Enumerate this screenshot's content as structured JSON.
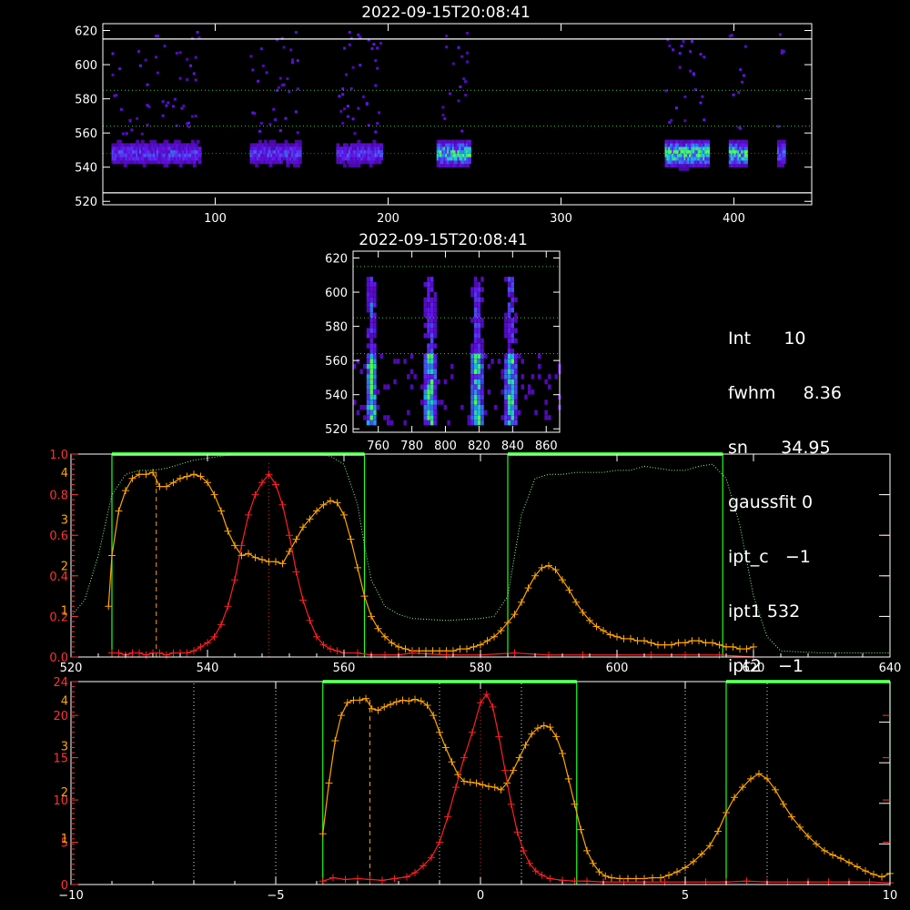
{
  "top_panel": {
    "title": "2022-09-15T20:08:41",
    "x_ticks": [
      "100",
      "200",
      "300",
      "400"
    ],
    "x_tick_values": [
      100,
      200,
      300,
      400
    ],
    "xlim": [
      35,
      445
    ],
    "y_ticks": [
      "520",
      "540",
      "560",
      "580",
      "600",
      "620"
    ],
    "y_tick_values": [
      520,
      540,
      560,
      580,
      600,
      620
    ],
    "ylim": [
      518,
      624
    ],
    "white_lines": [
      525,
      615
    ],
    "green_dotted_lines": [
      564,
      585,
      615
    ],
    "red_dotted_line": 548,
    "blobs": [
      {
        "x0": 40,
        "x1": 90,
        "intensity": 0.45
      },
      {
        "x0": 120,
        "x1": 148,
        "intensity": 0.45
      },
      {
        "x0": 170,
        "x1": 195,
        "intensity": 0.45
      },
      {
        "x0": 228,
        "x1": 246,
        "intensity": 0.9
      },
      {
        "x0": 360,
        "x1": 384,
        "intensity": 1.0
      },
      {
        "x0": 397,
        "x1": 406,
        "intensity": 0.9
      },
      {
        "x0": 425,
        "x1": 428,
        "intensity": 0.6
      }
    ]
  },
  "mid_panel": {
    "title": "2022-09-15T20:08:41",
    "x_ticks": [
      "760",
      "780",
      "800",
      "820",
      "840",
      "860"
    ],
    "x_tick_values": [
      760,
      780,
      800,
      820,
      840,
      860
    ],
    "xlim": [
      745,
      868
    ],
    "y_ticks": [
      "520",
      "540",
      "560",
      "580",
      "600",
      "620"
    ],
    "y_tick_values": [
      520,
      540,
      560,
      580,
      600,
      620
    ],
    "ylim": [
      518,
      624
    ],
    "stripes": [
      755,
      790,
      818,
      838
    ],
    "green_dotted_lines": [
      564,
      585,
      615
    ]
  },
  "info_text": [
    {
      "label": "Int",
      "value": "10",
      "line": "Int      10"
    },
    {
      "label": "fwhm",
      "value": "8.36",
      "line": "fwhm     8.36"
    },
    {
      "label": "sn",
      "value": "34.95",
      "line": "sn      34.95"
    },
    {
      "label": "gaussfit",
      "value": "0",
      "line": "gaussfit 0"
    },
    {
      "label": "ipt_c",
      "value": "−1",
      "line": "ipt_c   −1"
    },
    {
      "label": "ipt1",
      "value": "532",
      "line": "ipt1 532"
    },
    {
      "label": "ipt2",
      "value": "−1",
      "line": "ipt2   −1"
    }
  ],
  "chart_data": [
    {
      "type": "line",
      "x_ticks": [
        "520",
        "540",
        "560",
        "580",
        "600",
        "620",
        "640"
      ],
      "x_tick_values": [
        520,
        540,
        560,
        580,
        600,
        620,
        640
      ],
      "xlim": [
        520,
        640
      ],
      "left_y_ticks": [
        "0.0",
        "0.2",
        "0.4",
        "0.6",
        "0.8",
        "1.0"
      ],
      "left_y_tick_values": [
        0,
        0.2,
        0.4,
        0.6,
        0.8,
        1.0
      ],
      "ylim": [
        0,
        1.0
      ],
      "overlay_y_ticks": [
        "1",
        "2",
        "3",
        "4"
      ],
      "overlay_y_tick_values": [
        0.23,
        0.45,
        0.68,
        0.91
      ],
      "filter_bands": [
        [
          526,
          563
        ],
        [
          584,
          615.5
        ]
      ],
      "vlines_dashed_orange": [
        532.5
      ],
      "vlines_dotted_red": [
        549
      ],
      "green_dotted": {
        "x": [
          520,
          522,
          524,
          526,
          528,
          530,
          532,
          534,
          536,
          538,
          540,
          542,
          544,
          546,
          548,
          550,
          552,
          554,
          556,
          558,
          560,
          562,
          563,
          564,
          566,
          568,
          570,
          575,
          580,
          582,
          584,
          586,
          588,
          590,
          592,
          594,
          596,
          598,
          600,
          602,
          604,
          606,
          608,
          610,
          612,
          614,
          616,
          618,
          620,
          622,
          624,
          630,
          640
        ],
        "y": [
          0.2,
          0.28,
          0.5,
          0.8,
          0.9,
          0.92,
          0.92,
          0.93,
          0.95,
          0.97,
          0.98,
          0.99,
          1.0,
          1.0,
          1.0,
          1.0,
          1.0,
          1.0,
          1.0,
          0.99,
          0.95,
          0.75,
          0.55,
          0.38,
          0.25,
          0.21,
          0.19,
          0.18,
          0.19,
          0.2,
          0.3,
          0.7,
          0.88,
          0.9,
          0.9,
          0.91,
          0.91,
          0.91,
          0.92,
          0.92,
          0.94,
          0.93,
          0.92,
          0.92,
          0.94,
          0.95,
          0.88,
          0.65,
          0.3,
          0.1,
          0.03,
          0.02,
          0.02
        ]
      },
      "series": [
        {
          "name": "",
          "color": "#ffa500",
          "x": [
            525.5,
            526,
            527,
            528,
            529,
            530,
            531,
            532,
            533,
            534,
            535,
            536,
            537,
            538,
            539,
            540,
            541,
            542,
            543,
            544,
            545,
            546,
            547,
            548,
            549,
            550,
            551,
            552,
            553,
            554,
            555,
            556,
            557,
            558,
            559,
            560,
            561,
            562,
            563,
            564,
            565,
            566,
            567,
            568,
            569,
            570,
            571,
            572,
            573,
            574,
            575,
            576,
            577,
            578,
            579,
            580,
            581,
            582,
            583,
            584,
            585,
            586,
            587,
            588,
            589,
            590,
            591,
            592,
            593,
            594,
            595,
            596,
            597,
            598,
            599,
            600,
            601,
            602,
            603,
            604,
            605,
            606,
            607,
            608,
            609,
            610,
            611,
            612,
            613,
            614,
            615,
            616,
            617,
            618,
            619,
            620
          ],
          "y": [
            0.25,
            0.5,
            0.72,
            0.82,
            0.88,
            0.9,
            0.9,
            0.91,
            0.84,
            0.84,
            0.86,
            0.88,
            0.89,
            0.9,
            0.89,
            0.86,
            0.8,
            0.72,
            0.62,
            0.55,
            0.5,
            0.51,
            0.49,
            0.48,
            0.47,
            0.47,
            0.46,
            0.52,
            0.58,
            0.64,
            0.68,
            0.72,
            0.75,
            0.77,
            0.76,
            0.7,
            0.58,
            0.44,
            0.3,
            0.2,
            0.14,
            0.1,
            0.07,
            0.05,
            0.04,
            0.03,
            0.03,
            0.03,
            0.03,
            0.03,
            0.03,
            0.03,
            0.04,
            0.04,
            0.05,
            0.06,
            0.08,
            0.1,
            0.13,
            0.17,
            0.21,
            0.27,
            0.34,
            0.4,
            0.44,
            0.45,
            0.43,
            0.38,
            0.33,
            0.27,
            0.22,
            0.18,
            0.15,
            0.13,
            0.11,
            0.1,
            0.09,
            0.09,
            0.08,
            0.08,
            0.07,
            0.06,
            0.06,
            0.06,
            0.07,
            0.07,
            0.08,
            0.08,
            0.07,
            0.07,
            0.06,
            0.05,
            0.05,
            0.04,
            0.04,
            0.05
          ]
        },
        {
          "name": "",
          "color": "#ff2020",
          "x": [
            526,
            527,
            528,
            529,
            530,
            531,
            532,
            533,
            534,
            535,
            536,
            537,
            538,
            539,
            540,
            541,
            542,
            543,
            544,
            545,
            546,
            547,
            548,
            549,
            550,
            551,
            552,
            553,
            554,
            555,
            556,
            557,
            558,
            559,
            560,
            562,
            564,
            566,
            568,
            570,
            575,
            580,
            585,
            590,
            595,
            600,
            605,
            610,
            615,
            620
          ],
          "y": [
            0.02,
            0.02,
            0.01,
            0.02,
            0.02,
            0.01,
            0.02,
            0.02,
            0.01,
            0.02,
            0.02,
            0.02,
            0.03,
            0.05,
            0.07,
            0.1,
            0.16,
            0.25,
            0.38,
            0.55,
            0.7,
            0.8,
            0.86,
            0.9,
            0.85,
            0.75,
            0.6,
            0.42,
            0.28,
            0.18,
            0.1,
            0.06,
            0.04,
            0.03,
            0.02,
            0.02,
            0.01,
            0.01,
            0.01,
            0.02,
            0.01,
            0.01,
            0.02,
            0.01,
            0.01,
            0.01,
            0.01,
            0.01,
            0.01,
            0.0
          ]
        }
      ]
    },
    {
      "type": "line",
      "x_ticks": [
        "−10",
        "−5",
        "0",
        "5",
        "10"
      ],
      "x_tick_values": [
        -10,
        -5,
        0,
        5,
        10
      ],
      "xlim": [
        -10,
        10
      ],
      "left_y_ticks": [
        "0",
        "5",
        "10",
        "15",
        "20",
        "24"
      ],
      "left_y_tick_values": [
        0,
        5,
        10,
        15,
        20,
        24
      ],
      "ylim": [
        0,
        24
      ],
      "overlay_y_ticks": [
        "1",
        "2",
        "3",
        "4"
      ],
      "overlay_y_tick_values": [
        5.5,
        11,
        16.4,
        21.8
      ],
      "filter_bands": [
        [
          -3.85,
          2.35
        ],
        [
          6.0,
          10.2
        ]
      ],
      "vlines_dashed_orange": [
        -2.7
      ],
      "vlines_dotted_white": [
        -7.0,
        -5.0,
        -1.0,
        1.0,
        5.0,
        7.0
      ],
      "vlines_dotted_red": [
        0
      ],
      "series": [
        {
          "name": "",
          "color": "#ffa500",
          "x": [
            -3.85,
            -3.7,
            -3.55,
            -3.4,
            -3.25,
            -3.1,
            -2.95,
            -2.8,
            -2.65,
            -2.5,
            -2.35,
            -2.2,
            -2.05,
            -1.9,
            -1.75,
            -1.6,
            -1.45,
            -1.3,
            -1.15,
            -1.0,
            -0.85,
            -0.7,
            -0.55,
            -0.4,
            -0.25,
            -0.1,
            0.05,
            0.2,
            0.35,
            0.5,
            0.65,
            0.8,
            0.95,
            1.1,
            1.25,
            1.4,
            1.55,
            1.7,
            1.85,
            2.0,
            2.15,
            2.3,
            2.45,
            2.6,
            2.75,
            2.9,
            3.05,
            3.2,
            3.4,
            3.6,
            3.8,
            4.0,
            4.2,
            4.4,
            4.6,
            4.8,
            5.0,
            5.2,
            5.4,
            5.6,
            5.8,
            6.0,
            6.2,
            6.4,
            6.6,
            6.8,
            7.0,
            7.2,
            7.4,
            7.6,
            7.8,
            8.0,
            8.2,
            8.4,
            8.6,
            8.8,
            9.0,
            9.2,
            9.4,
            9.6,
            9.8,
            10.0
          ],
          "y": [
            6,
            12,
            17,
            20,
            21.5,
            21.8,
            21.8,
            22,
            20.8,
            20.6,
            21,
            21.3,
            21.6,
            21.8,
            21.7,
            21.9,
            21.7,
            21.2,
            20,
            18,
            16.2,
            14.5,
            13,
            12.2,
            12.1,
            12,
            11.8,
            11.6,
            11.5,
            11.2,
            12,
            13.5,
            15,
            16.5,
            17.8,
            18.5,
            18.8,
            18.6,
            17.5,
            15.5,
            12.5,
            9.5,
            6.5,
            4,
            2.5,
            1.5,
            1,
            0.8,
            0.7,
            0.7,
            0.7,
            0.7,
            0.8,
            0.8,
            1.1,
            1.5,
            2,
            2.7,
            3.6,
            4.6,
            6.3,
            8.5,
            10.3,
            11.5,
            12.5,
            13.1,
            12.5,
            11.2,
            9.5,
            8,
            6.8,
            5.7,
            4.8,
            4,
            3.5,
            3.1,
            2.6,
            2.1,
            1.6,
            1.2,
            0.9,
            1.3
          ]
        },
        {
          "name": "",
          "color": "#ff2020",
          "x": [
            -3.85,
            -3.6,
            -3.3,
            -3.0,
            -2.7,
            -2.4,
            -2.1,
            -1.8,
            -1.6,
            -1.4,
            -1.2,
            -1.0,
            -0.8,
            -0.6,
            -0.4,
            -0.2,
            0.0,
            0.15,
            0.3,
            0.45,
            0.6,
            0.75,
            0.9,
            1.05,
            1.2,
            1.35,
            1.5,
            1.7,
            2.0,
            2.3,
            2.6,
            3.0,
            3.5,
            4.0,
            4.5,
            5.0,
            5.5,
            6.0,
            6.5,
            7.0,
            7.5,
            8.0,
            8.5,
            9.0,
            9.5,
            10.0
          ],
          "y": [
            0.4,
            0.8,
            0.6,
            0.7,
            0.6,
            0.5,
            0.7,
            0.9,
            1.4,
            2.2,
            3.2,
            5,
            8,
            11.5,
            15,
            18,
            21.5,
            22.5,
            21,
            17.5,
            13.5,
            9.5,
            6.2,
            4,
            2.5,
            1.6,
            1.1,
            0.7,
            0.5,
            0.4,
            0.4,
            0.3,
            0.3,
            0.3,
            0.3,
            0.3,
            0.3,
            0.3,
            0.4,
            0.3,
            0.3,
            0.3,
            0.3,
            0.3,
            0.3,
            0.2
          ]
        }
      ]
    }
  ]
}
